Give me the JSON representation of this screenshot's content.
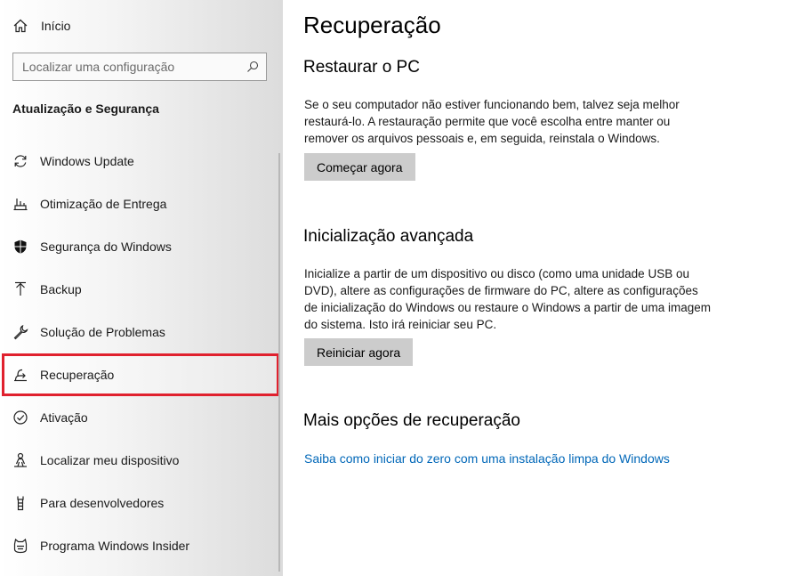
{
  "sidebar": {
    "home": {
      "label": "Início",
      "icon": "home-icon"
    },
    "search": {
      "placeholder": "Localizar uma configuração",
      "icon": "search-icon"
    },
    "section_title": "Atualização e Segurança",
    "items": [
      {
        "label": "Windows Update",
        "icon": "refresh-icon"
      },
      {
        "label": "Otimização de Entrega",
        "icon": "delivery-optimization-icon"
      },
      {
        "label": "Segurança do Windows",
        "icon": "shield-icon"
      },
      {
        "label": "Backup",
        "icon": "backup-arrow-icon"
      },
      {
        "label": "Solução de Problemas",
        "icon": "wrench-icon"
      },
      {
        "label": "Recuperação",
        "icon": "recovery-icon",
        "selected": true
      },
      {
        "label": "Ativação",
        "icon": "check-circle-icon"
      },
      {
        "label": "Localizar meu dispositivo",
        "icon": "person-location-icon"
      },
      {
        "label": "Para desenvolvedores",
        "icon": "developer-icon"
      },
      {
        "label": "Programa Windows Insider",
        "icon": "insider-cat-icon"
      }
    ]
  },
  "main": {
    "title": "Recuperação",
    "reset": {
      "heading": "Restaurar o PC",
      "description": "Se o seu computador não estiver funcionando bem, talvez seja melhor restaurá-lo. A restauração permite que você escolha entre manter ou remover os arquivos pessoais e, em seguida, reinstala o Windows.",
      "button": "Começar agora"
    },
    "advanced": {
      "heading": "Inicialização avançada",
      "description": "Inicialize a partir de um dispositivo ou disco (como uma unidade USB ou DVD), altere as configurações de firmware do PC, altere as configurações de inicialização do Windows ou restaure o Windows a partir de uma imagem do sistema. Isto irá reiniciar seu PC.",
      "button": "Reiniciar agora"
    },
    "more": {
      "heading": "Mais opções de recuperação",
      "link": "Saiba como iniciar do zero com uma instalação limpa do Windows"
    }
  },
  "colors": {
    "accent_link": "#0067b8",
    "selection_outline": "#e0212e",
    "button_bg": "#cccccc"
  }
}
